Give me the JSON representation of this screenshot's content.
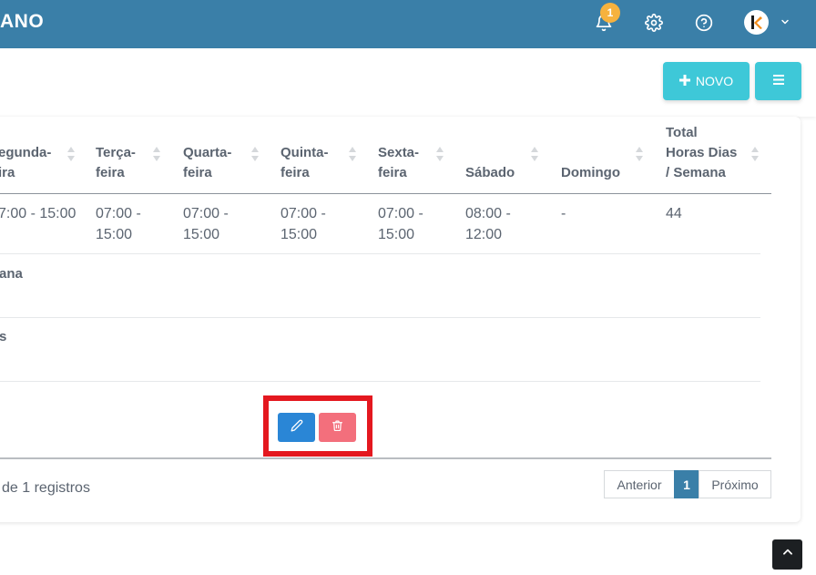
{
  "header": {
    "brand_fragment": "ANO",
    "notification_count": "1",
    "bg_color": "#3a7fa8"
  },
  "toolbar": {
    "new_label": "NOVO",
    "new_icon": "plus-icon",
    "menu_icon": "hamburger-icon",
    "accent_color": "#3ec8d8"
  },
  "table": {
    "columns": [
      {
        "line1": "egunda-",
        "line2": "ira"
      },
      {
        "line1": "Terça-",
        "line2": "feira"
      },
      {
        "line1": "Quarta-",
        "line2": "feira"
      },
      {
        "line1": "Quinta-",
        "line2": "feira"
      },
      {
        "line1": "Sexta-",
        "line2": "feira"
      },
      {
        "line1": "Sábado",
        "line2": ""
      },
      {
        "line1": "Domingo",
        "line2": ""
      },
      {
        "line1": "Total",
        "line2": "Horas Dias",
        "line3": "/ Semana"
      }
    ],
    "row1": {
      "segunda": "7:00 - 15:00",
      "terca_1": "07:00 -",
      "terca_2": "15:00",
      "quarta_1": "07:00 -",
      "quarta_2": "15:00",
      "quinta_1": "07:00 -",
      "quinta_2": "15:00",
      "sexta_1": "07:00 -",
      "sexta_2": "15:00",
      "sabado_1": "08:00 -",
      "sabado_2": "12:00",
      "domingo": "-",
      "total": "44"
    },
    "row2_label": "ana",
    "row3_label": "s"
  },
  "actions": {
    "edit_icon": "pencil-icon",
    "delete_icon": "trash-icon",
    "edit_color": "#2a86d6",
    "delete_color": "#f36f7c",
    "highlight_color": "#e4181f"
  },
  "footer": {
    "info_text": "de 1 registros",
    "prev_label": "Anterior",
    "page_label": "1",
    "next_label": "Próximo"
  }
}
